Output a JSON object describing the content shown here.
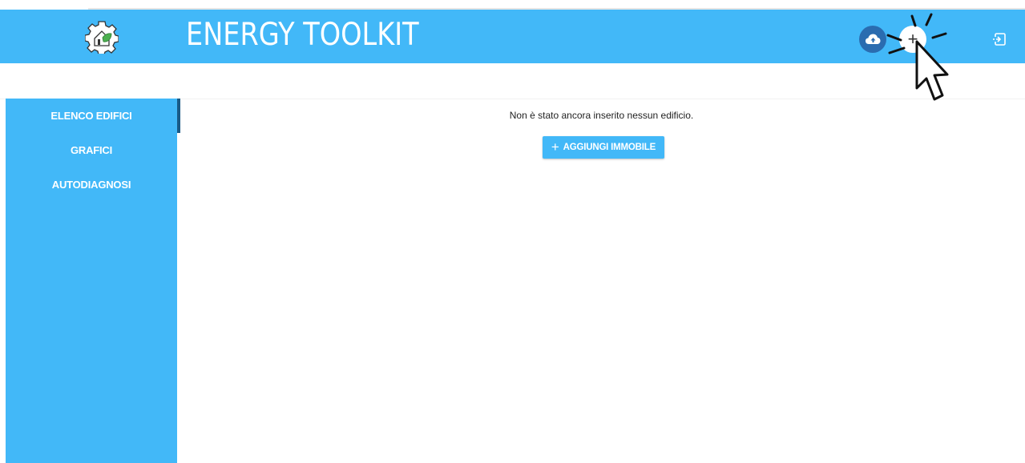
{
  "header": {
    "title": "ENERGY TOOLKIT",
    "brand_color": "#42b8f8",
    "icons": {
      "logo": "gear-house-leaf-logo",
      "cloud": "cloud-upload-icon",
      "add": "plus-icon",
      "logout": "logout-icon"
    },
    "add_symbol": "+"
  },
  "sidebar": {
    "items": [
      {
        "label": "ELENCO EDIFICI",
        "active": true
      },
      {
        "label": "GRAFICI",
        "active": false
      },
      {
        "label": "AUTODIAGNOSI",
        "active": false
      }
    ]
  },
  "main": {
    "empty_message": "Non è stato ancora inserito nessun edificio.",
    "add_button": {
      "icon": "+",
      "label": "AGGIUNGI IMMOBILE"
    }
  }
}
